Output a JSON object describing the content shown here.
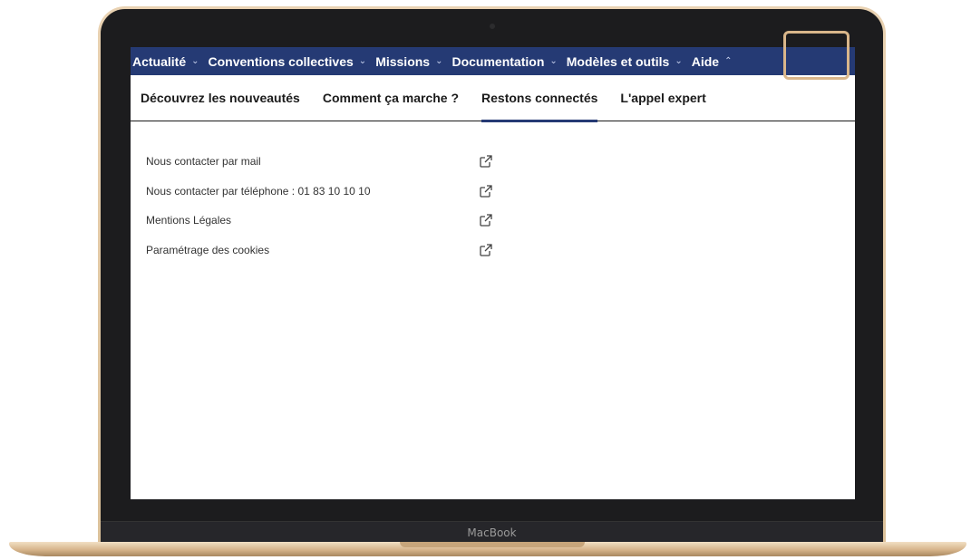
{
  "device": {
    "brand": "MacBook"
  },
  "nav": {
    "items": [
      {
        "label": "Actualité",
        "chevron": "v"
      },
      {
        "label": "Conventions collectives",
        "chevron": "v"
      },
      {
        "label": "Missions",
        "chevron": "v"
      },
      {
        "label": "Documentation",
        "chevron": "v"
      },
      {
        "label": "Modèles et outils",
        "chevron": "v"
      },
      {
        "label": "Aide",
        "chevron": "^"
      }
    ],
    "active_index": 5
  },
  "subnav": {
    "tabs": [
      {
        "label": "Découvrez les nouveautés"
      },
      {
        "label": "Comment ça marche ?"
      },
      {
        "label": "Restons connectés"
      },
      {
        "label": "L'appel expert"
      }
    ],
    "active_index": 2
  },
  "links": [
    {
      "label": "Nous contacter par mail",
      "icon": "external-link-icon"
    },
    {
      "label": "Nous contacter par téléphone : 01 83 10 10 10",
      "icon": "external-link-icon"
    },
    {
      "label": "Mentions Légales",
      "icon": "external-link-icon"
    },
    {
      "label": "Paramétrage des cookies",
      "icon": "external-link-icon"
    }
  ],
  "colors": {
    "nav_bg": "#253a74",
    "highlight_border": "#d9b68a",
    "active_underline": "#253a74"
  }
}
